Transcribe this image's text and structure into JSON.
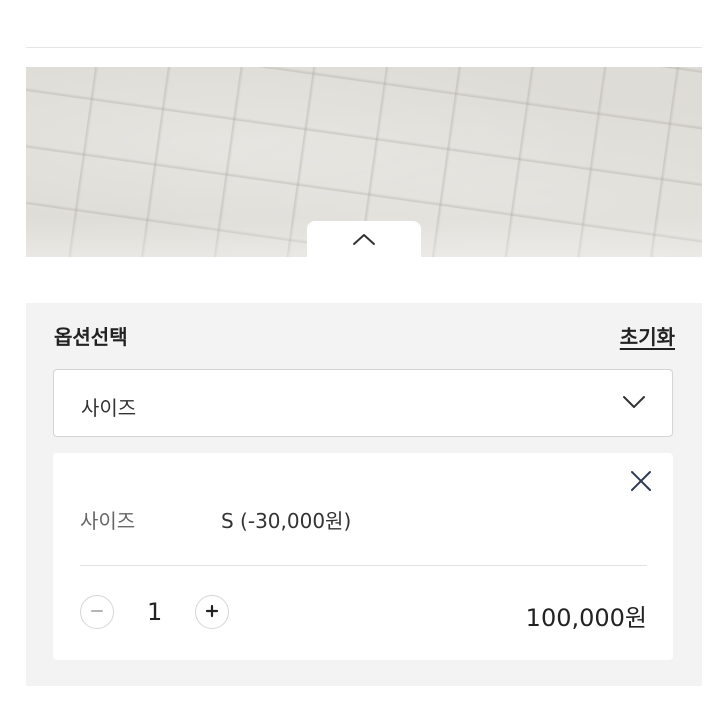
{
  "header": {
    "collapse_icon": "chevron-up-icon"
  },
  "option_panel": {
    "title": "옵션선택",
    "reset_label": "초기화",
    "select": {
      "value": "사이즈",
      "icon": "chevron-down-icon"
    },
    "selected_item": {
      "option_label": "사이즈",
      "option_value": "S (-30,000원)",
      "quantity": "1",
      "price": "100,000원",
      "remove_icon": "close-icon",
      "minus_icon": "minus-icon",
      "plus_icon": "plus-icon"
    }
  },
  "colors": {
    "panel_background": "#f3f3f3",
    "card_background": "#ffffff",
    "remove_icon_color": "#2f3a55",
    "disabled_minus_color": "#b5b5b5"
  }
}
